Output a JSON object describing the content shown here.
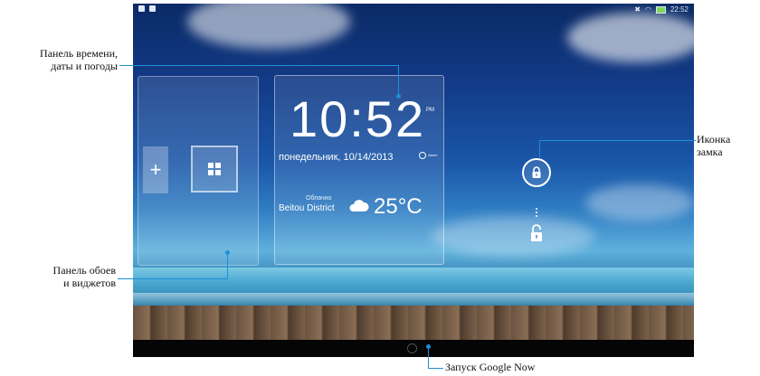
{
  "status_bar": {
    "time": "22:52",
    "icons_left": [
      "notification-icon",
      "image-icon"
    ],
    "icons_right": [
      "mute-icon",
      "wifi-icon",
      "battery-icon"
    ]
  },
  "time_panel": {
    "time": "10:52",
    "ampm": "PM",
    "date": "понедельник, 10/14/2013",
    "alarm_label": "Alarm",
    "weather_condition": "Облачно",
    "location": "Beitou District",
    "temperature": "25°C"
  },
  "wallpaper_panel": {
    "add_symbol": "+"
  },
  "annotations": {
    "time_panel": "Панель времени,\nдаты и погоды",
    "lock_icon": "Иконка\nзамка",
    "wallpaper_panel": "Панель обоев\nи виджетов",
    "google_now": "Запуск Google Now"
  },
  "colors": {
    "callout": "#1f8fd8",
    "battery": "#7ed957"
  }
}
